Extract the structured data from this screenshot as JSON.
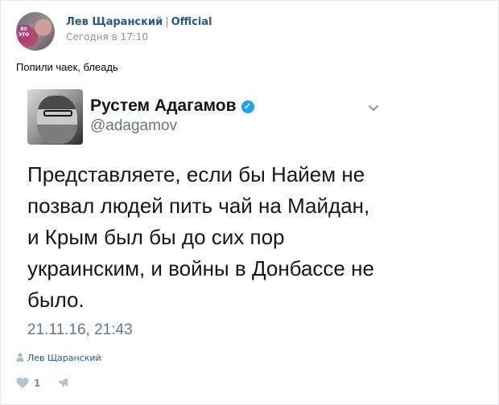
{
  "post": {
    "author": "Лев Щаранский",
    "author_suffix": "Official",
    "separator": "|",
    "date": "Сегодня в 17:10",
    "text": "Попили чаек, блеадь",
    "signer": "Лев Щаранский",
    "likes": "1"
  },
  "tweet": {
    "name": "Рустем Адагамов",
    "handle": "@adagamov",
    "lines": [
      "Представляете, если бы Найем не",
      "позвал людей пить чай на Майдан,",
      "и Крым был бы до сих пор",
      "украинским, и войны в Донбассе не",
      "было."
    ],
    "date": "21.11.16, 21:43"
  },
  "icons": {
    "verified": "verified-badge-icon",
    "chevron": "chevron-down-icon",
    "signer": "user-icon",
    "like": "heart-icon",
    "share": "megaphone-icon"
  },
  "colors": {
    "link": "#2a5885",
    "meta": "#939393",
    "twitter_blue": "#1da1f2",
    "twitter_gray": "#657786"
  }
}
